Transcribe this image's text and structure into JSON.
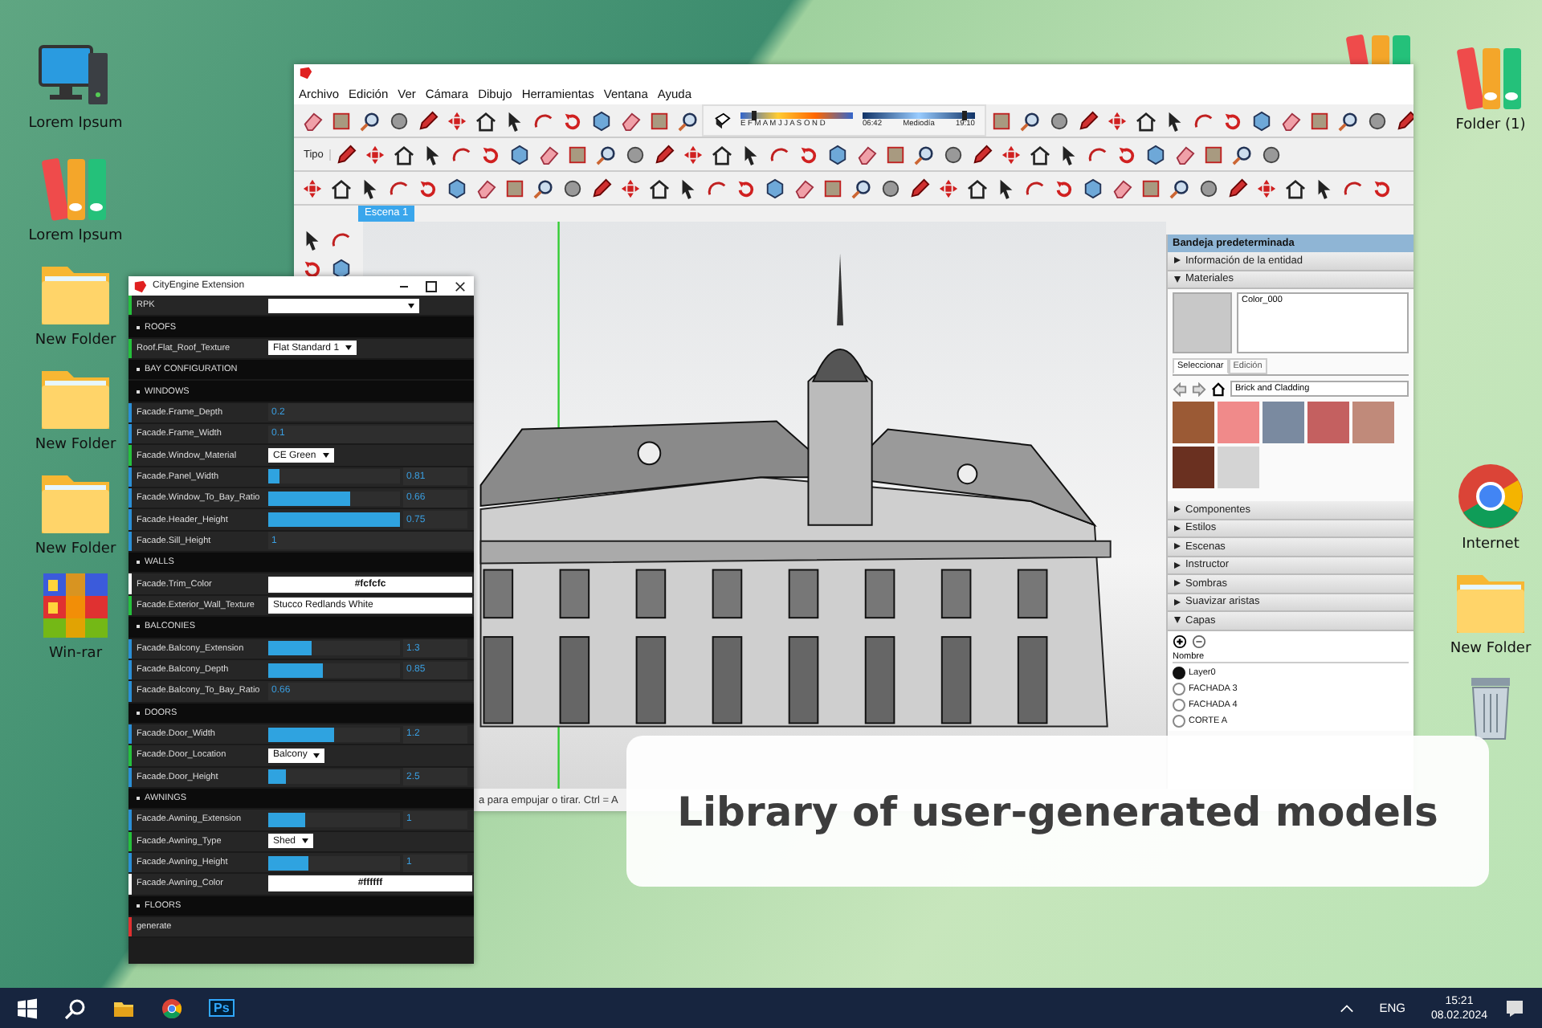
{
  "desktop_left": [
    {
      "kind": "computer",
      "label": "Lorem Ipsum"
    },
    {
      "kind": "binders",
      "label": "Lorem Ipsum"
    },
    {
      "kind": "folder",
      "label": "New Folder"
    },
    {
      "kind": "folder",
      "label": "New Folder"
    },
    {
      "kind": "folder",
      "label": "New Folder"
    },
    {
      "kind": "winrar",
      "label": "Win-rar"
    }
  ],
  "desktop_right": [
    {
      "kind": "binders"
    },
    {
      "kind": "binders",
      "label": "Folder (1)"
    },
    {
      "kind": "browser",
      "label": "Internet"
    },
    {
      "kind": "folder",
      "label": "New Folder"
    },
    {
      "kind": "trash"
    }
  ],
  "sketchup": {
    "menu": [
      "Archivo",
      "Edición",
      "Ver",
      "Cámara",
      "Dibujo",
      "Herramientas",
      "Ventana",
      "Ayuda"
    ],
    "shadow_date": {
      "months": "E F M A M J J A S O N D",
      "level": 0.12
    },
    "shadow_time": {
      "labels": [
        "06:42",
        "Mediodía",
        "19:10"
      ],
      "level": 0.9
    },
    "toolbar_label": "Tipo",
    "scene_tab": "Escena 1",
    "status_text": "a para empujar o tirar. Ctrl = A",
    "tray": {
      "title": "Bandeja predeterminada",
      "sections": [
        {
          "kind": "plain",
          "label": "Información de la entidad",
          "expanded": false
        },
        {
          "kind": "materials",
          "label": "Materiales",
          "expanded": true
        },
        {
          "kind": "plain",
          "label": "Componentes",
          "expanded": false
        },
        {
          "kind": "plain",
          "label": "Estilos",
          "expanded": false
        },
        {
          "kind": "plain",
          "label": "Escenas",
          "expanded": false
        },
        {
          "kind": "plain",
          "label": "Instructor",
          "expanded": false
        },
        {
          "kind": "plain",
          "label": "Sombras",
          "expanded": false
        },
        {
          "kind": "plain",
          "label": "Suavizar aristas",
          "expanded": false
        },
        {
          "kind": "layers",
          "label": "Capas",
          "expanded": true
        }
      ],
      "material_name": "Color_000",
      "material_tabs": [
        {
          "label": "Seleccionar",
          "selected": true
        },
        {
          "label": "Edición",
          "selected": false
        }
      ],
      "library": "Brick and Cladding",
      "swatches": [
        {
          "color": "#9b5a35"
        },
        {
          "color": "#f08a8a"
        },
        {
          "color": "#7a8aa0"
        },
        {
          "color": "#c46060"
        },
        {
          "color": "#c08a7a"
        },
        {
          "color": "#6a3020"
        },
        {
          "color": "#d4d4d4"
        }
      ],
      "layers_header": "Nombre",
      "layers": [
        {
          "name": "Layer0",
          "selected": true
        },
        {
          "name": "FACHADA 3",
          "selected": false
        },
        {
          "name": "FACHADA 4",
          "selected": false
        },
        {
          "name": "CORTE A",
          "selected": false
        }
      ]
    }
  },
  "cityengine": {
    "title": "CityEngine Extension",
    "rows": [
      {
        "kind": "dropdown",
        "label": "RPK"
      },
      {
        "kind": "section",
        "label": "ROOFS"
      },
      {
        "kind": "dropdown",
        "label": "Roof.Flat_Roof_Texture",
        "value": "Flat Standard 1"
      },
      {
        "kind": "section",
        "label": "BAY CONFIGURATION"
      },
      {
        "kind": "section",
        "label": "WINDOWS"
      },
      {
        "kind": "number",
        "label": "Facade.Frame_Depth",
        "value": "0.2"
      },
      {
        "kind": "number",
        "label": "Facade.Frame_Width",
        "value": "0.1"
      },
      {
        "kind": "dropdown",
        "label": "Facade.Window_Material",
        "value": "CE Green"
      },
      {
        "kind": "slider",
        "label": "Facade.Panel_Width",
        "level": 0.08,
        "reading": "0.81"
      },
      {
        "kind": "slider",
        "label": "Facade.Window_To_Bay_Ratio",
        "level": 0.62,
        "reading": "0.66"
      },
      {
        "kind": "slider",
        "label": "Facade.Header_Height",
        "level": 1,
        "reading": "0.75"
      },
      {
        "kind": "number",
        "label": "Facade.Sill_Height",
        "value": "1"
      },
      {
        "kind": "section",
        "label": "WALLS"
      },
      {
        "kind": "color",
        "label": "Facade.Trim_Color",
        "value": "#fcfcfc"
      },
      {
        "kind": "text",
        "label": "Facade.Exterior_Wall_Texture",
        "value": "Stucco Redlands White"
      },
      {
        "kind": "section",
        "label": "BALCONIES"
      },
      {
        "kind": "slider",
        "label": "Facade.Balcony_Extension",
        "level": 0.33,
        "reading": "1.3"
      },
      {
        "kind": "slider",
        "label": "Facade.Balcony_Depth",
        "level": 0.41,
        "reading": "0.85"
      },
      {
        "kind": "number",
        "label": "Facade.Balcony_To_Bay_Ratio",
        "value": "0.66"
      },
      {
        "kind": "section",
        "label": "DOORS"
      },
      {
        "kind": "slider",
        "label": "Facade.Door_Width",
        "level": 0.5,
        "reading": "1.2"
      },
      {
        "kind": "dropdown",
        "label": "Facade.Door_Location",
        "value": "Balcony"
      },
      {
        "kind": "slider",
        "label": "Facade.Door_Height",
        "level": 0.14,
        "reading": "2.5"
      },
      {
        "kind": "section",
        "label": "AWNINGS"
      },
      {
        "kind": "slider",
        "label": "Facade.Awning_Extension",
        "level": 0.28,
        "reading": "1"
      },
      {
        "kind": "dropdown",
        "label": "Facade.Awning_Type",
        "value": "Shed"
      },
      {
        "kind": "slider",
        "label": "Facade.Awning_Height",
        "level": 0.3,
        "reading": "1"
      },
      {
        "kind": "color",
        "label": "Facade.Awning_Color",
        "value": "#ffffff"
      },
      {
        "kind": "section",
        "label": "FLOORS"
      },
      {
        "kind": "button",
        "label": "generate"
      }
    ]
  },
  "caption": "Library of user-generated models",
  "taskbar": {
    "app_label": "Ps",
    "language": "ENG",
    "time": "15:21",
    "date": "08.02.2024"
  }
}
